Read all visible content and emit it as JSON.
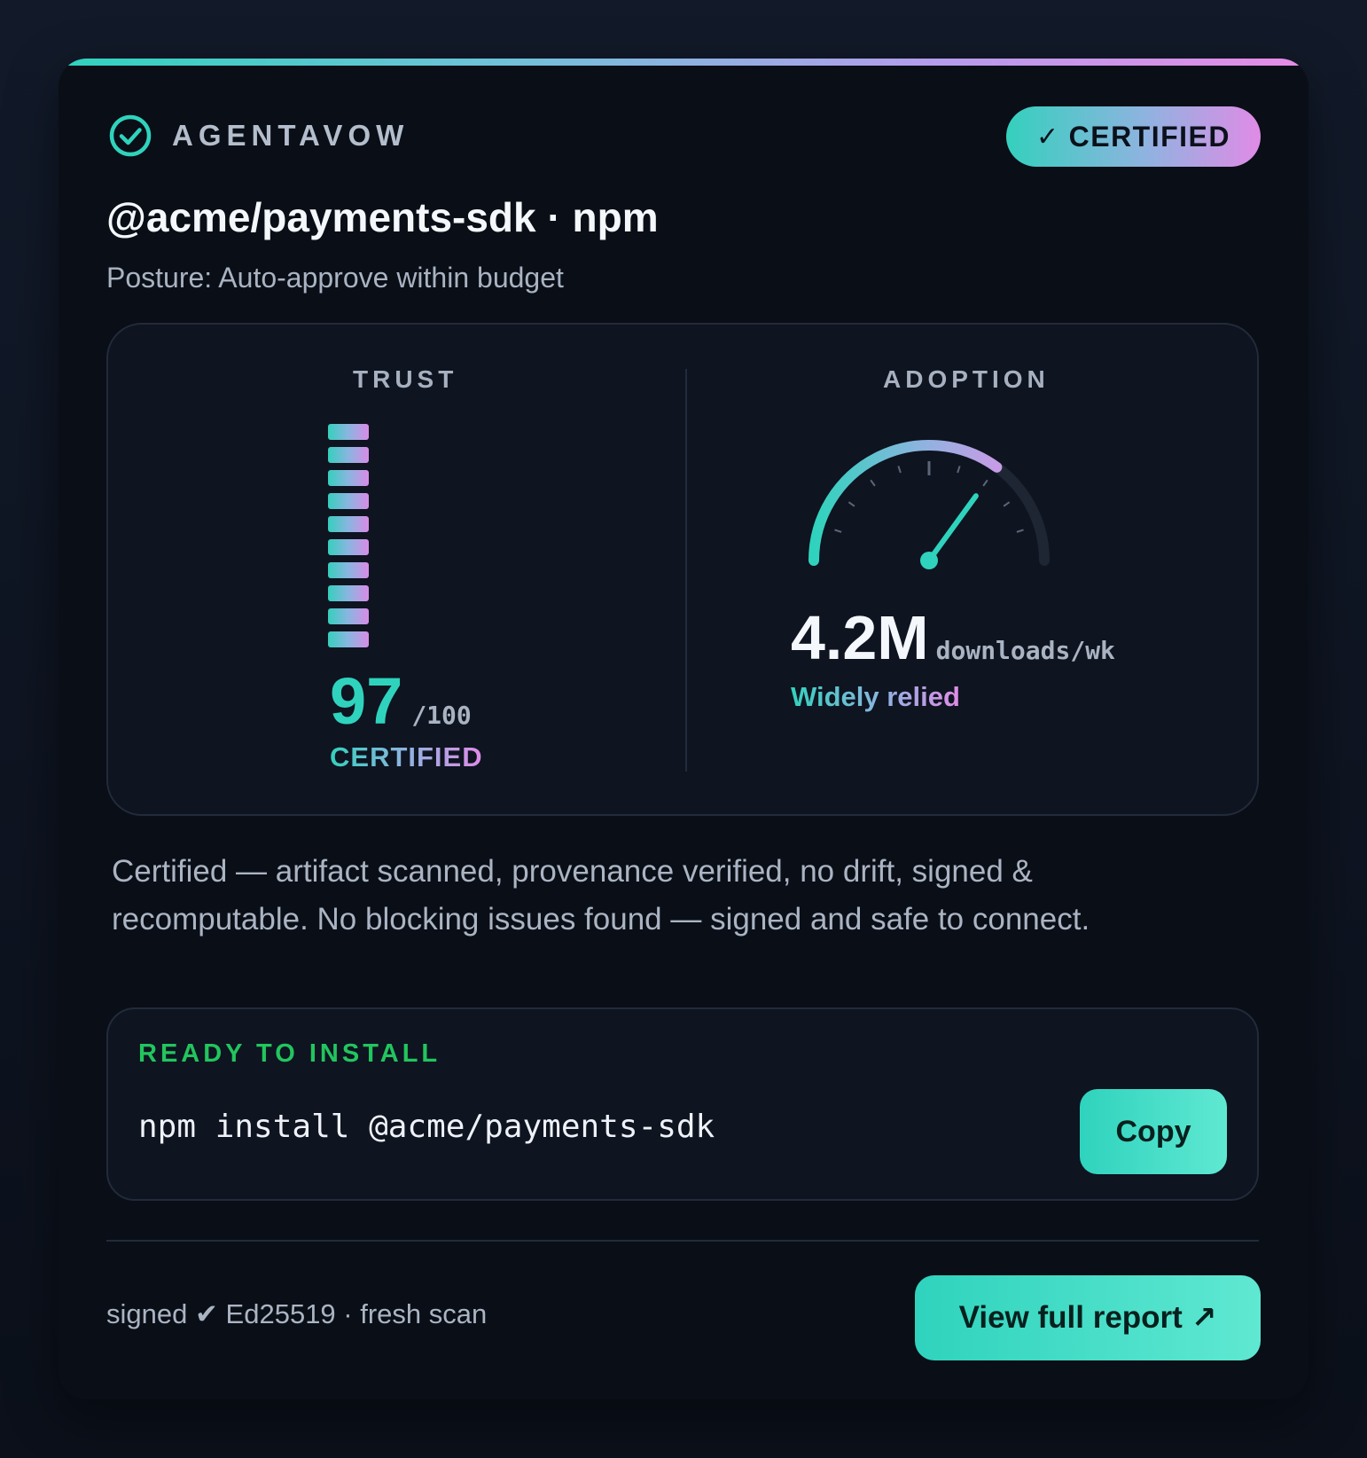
{
  "brand": {
    "name": "AGENTAVOW",
    "icon": "check-circle-icon"
  },
  "badge": {
    "check": "✓",
    "label": "CERTIFIED"
  },
  "package": {
    "title": "@acme/payments-sdk · npm",
    "posture": "Posture: Auto-approve within budget"
  },
  "trust": {
    "label": "TRUST",
    "score": 97,
    "score_text": "97",
    "max_text": "/100",
    "status": "CERTIFIED",
    "bar_count": 10
  },
  "adoption": {
    "label": "ADOPTION",
    "value": "4.2M",
    "unit": "downloads/wk",
    "status": "Widely relied",
    "gauge_level": 0.7
  },
  "summary": "Certified — artifact scanned, provenance verified, no drift, signed & recomputable. No blocking issues found — signed and safe to connect.",
  "install": {
    "label": "READY TO INSTALL",
    "command": "npm install @acme/payments-sdk",
    "copy_label": "Copy"
  },
  "footer": {
    "signature": "signed ✔ Ed25519 · fresh scan",
    "report_label": "View full report",
    "report_icon": "↗"
  },
  "colors": {
    "accent": "#2fd3bd",
    "accent_light": "#5fe8d2",
    "gradient_end": "#e68ce6",
    "ready_green": "#22c55e",
    "card_bg": "#0a0e16",
    "panel_bg": "#0e1420"
  }
}
